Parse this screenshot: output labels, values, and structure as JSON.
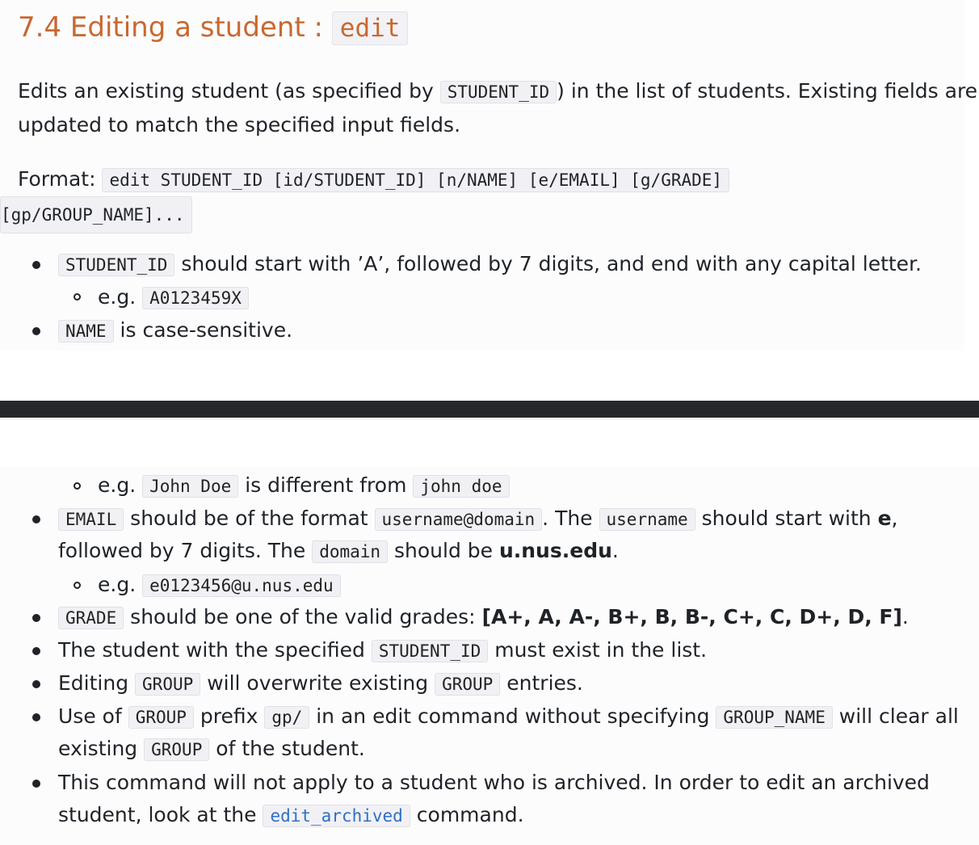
{
  "heading": {
    "text": "7.4 Editing a student : ",
    "code": "edit"
  },
  "intro": {
    "line1_pre": "Edits an existing student (as specified by ",
    "line1_code": "STUDENT_ID",
    "line1_post": ") in the list of students. Existing fields are",
    "line2": "updated to match the specified input fields."
  },
  "format": {
    "label": "Format: ",
    "code_line1": "edit STUDENT_ID [id/STUDENT_ID] [n/NAME] [e/EMAIL] [g/GRADE]",
    "code_line2": "[gp/GROUP_NAME]..."
  },
  "top_bullets": {
    "b1_code": "STUDENT_ID",
    "b1_text": " should start with ’A’, followed by 7 digits, and end with any capital letter.",
    "b1_sub_pre": "e.g. ",
    "b1_sub_code": "A0123459X",
    "b2_code": "NAME",
    "b2_text": " is case-sensitive."
  },
  "bottom_bullets": {
    "name_sub_pre": "e.g. ",
    "name_sub_code1": "John Doe",
    "name_sub_mid": " is different from ",
    "name_sub_code2": "john doe",
    "email_code": "EMAIL",
    "email_t1": " should be of the format ",
    "email_code2": "username@domain",
    "email_t2": ". The ",
    "email_code3": "username",
    "email_t3": " should start with ",
    "email_bold1": "e",
    "email_t4": ",",
    "email_l2_t1": "followed by 7 digits. The ",
    "email_l2_code": "domain",
    "email_l2_t2": " should be ",
    "email_l2_bold": "u.nus.edu",
    "email_l2_t3": ".",
    "email_sub_pre": "e.g. ",
    "email_sub_code": "e0123456@u.nus.edu",
    "grade_code": "GRADE",
    "grade_text": " should be one of the valid grades: ",
    "grade_bold": "[A+, A, A-, B+, B, B-, C+, C, D+, D, F]",
    "grade_end": ".",
    "exist_pre": "The student with the specified ",
    "exist_code": "STUDENT_ID",
    "exist_post": " must exist in the list.",
    "group_pre": "Editing ",
    "group_code1": "GROUP",
    "group_mid": " will overwrite existing ",
    "group_code2": "GROUP",
    "group_post": " entries.",
    "gp_t1": "Use of ",
    "gp_code1": "GROUP",
    "gp_t2": " prefix ",
    "gp_code2": "gp/",
    "gp_t3": " in an edit command without specifying ",
    "gp_code3": "GROUP_NAME",
    "gp_t4": " will clear all",
    "gp_l2_t1": "existing ",
    "gp_l2_code": "GROUP",
    "gp_l2_t2": " of the student.",
    "arch_l1": "This command will not apply to a student who is archived. In order to edit an archived",
    "arch_l2_t1": "student, look at the ",
    "arch_l2_code": "edit_archived",
    "arch_l2_t2": " command."
  }
}
